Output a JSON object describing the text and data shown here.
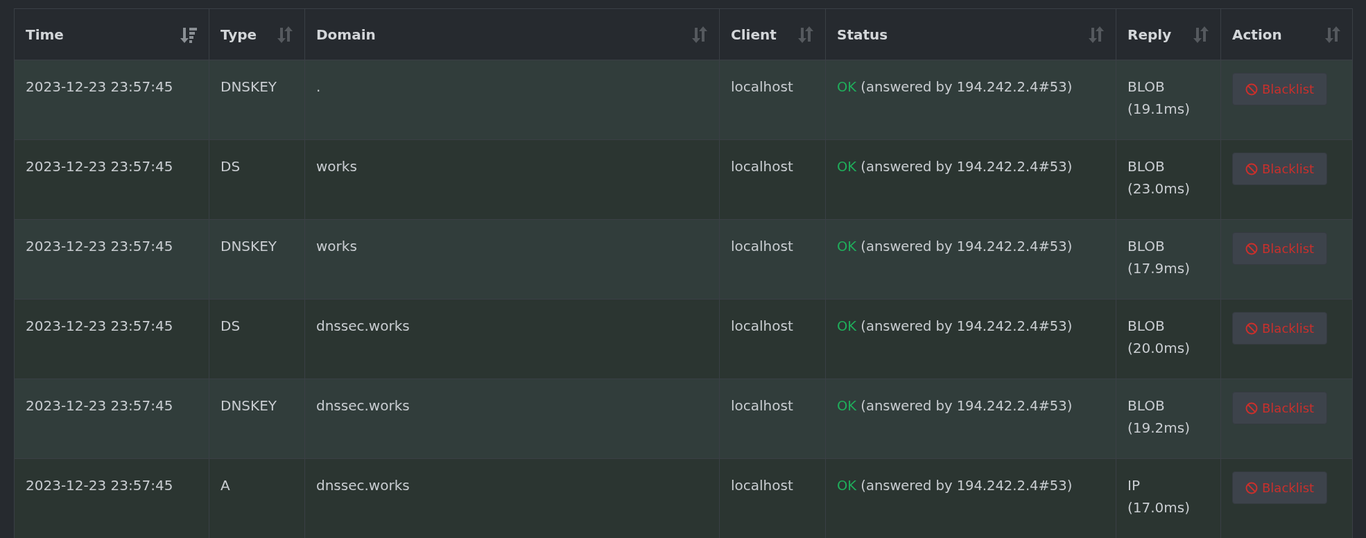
{
  "table": {
    "columns": [
      {
        "label": "Time",
        "sorted": true
      },
      {
        "label": "Type",
        "sorted": false
      },
      {
        "label": "Domain",
        "sorted": false
      },
      {
        "label": "Client",
        "sorted": false
      },
      {
        "label": "Status",
        "sorted": false
      },
      {
        "label": "Reply",
        "sorted": false
      },
      {
        "label": "Action",
        "sorted": false
      }
    ],
    "rows": [
      {
        "time": "2023-12-23 23:57:45",
        "type": "DNSKEY",
        "domain": ".",
        "client": "localhost",
        "status": "OK",
        "detail": "(answered by 194.242.2.4#53)",
        "reply": "BLOB",
        "duration": "(19.1ms)",
        "action": "Blacklist"
      },
      {
        "time": "2023-12-23 23:57:45",
        "type": "DS",
        "domain": "works",
        "client": "localhost",
        "status": "OK",
        "detail": "(answered by 194.242.2.4#53)",
        "reply": "BLOB",
        "duration": "(23.0ms)",
        "action": "Blacklist"
      },
      {
        "time": "2023-12-23 23:57:45",
        "type": "DNSKEY",
        "domain": "works",
        "client": "localhost",
        "status": "OK",
        "detail": "(answered by 194.242.2.4#53)",
        "reply": "BLOB",
        "duration": "(17.9ms)",
        "action": "Blacklist"
      },
      {
        "time": "2023-12-23 23:57:45",
        "type": "DS",
        "domain": "dnssec.works",
        "client": "localhost",
        "status": "OK",
        "detail": "(answered by 194.242.2.4#53)",
        "reply": "BLOB",
        "duration": "(20.0ms)",
        "action": "Blacklist"
      },
      {
        "time": "2023-12-23 23:57:45",
        "type": "DNSKEY",
        "domain": "dnssec.works",
        "client": "localhost",
        "status": "OK",
        "detail": "(answered by 194.242.2.4#53)",
        "reply": "BLOB",
        "duration": "(19.2ms)",
        "action": "Blacklist"
      },
      {
        "time": "2023-12-23 23:57:45",
        "type": "A",
        "domain": "dnssec.works",
        "client": "localhost",
        "status": "OK",
        "detail": "(answered by 194.242.2.4#53)",
        "reply": "IP",
        "duration": "(17.0ms)",
        "action": "Blacklist"
      }
    ]
  }
}
